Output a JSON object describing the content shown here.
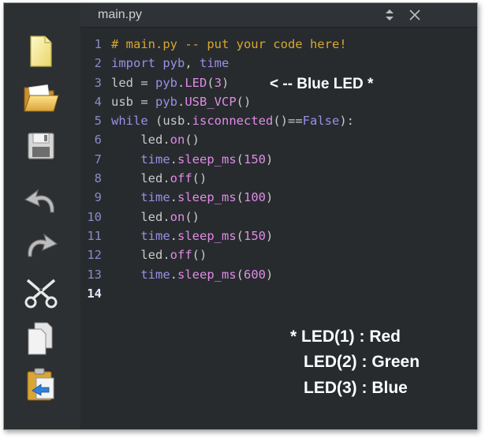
{
  "tab": {
    "title": "main.py"
  },
  "toolbar": {
    "buttons": [
      {
        "name": "new-file",
        "icon": "new-file-icon"
      },
      {
        "name": "open-folder",
        "icon": "folder-icon"
      },
      {
        "name": "save",
        "icon": "save-icon"
      },
      {
        "name": "undo",
        "icon": "undo-icon"
      },
      {
        "name": "redo",
        "icon": "redo-icon"
      },
      {
        "name": "cut",
        "icon": "scissors-icon"
      },
      {
        "name": "copy",
        "icon": "copy-icon"
      },
      {
        "name": "paste",
        "icon": "paste-icon"
      }
    ]
  },
  "code": {
    "lines": [
      {
        "n": "1",
        "tokens": [
          [
            "com",
            "# main.py -- put your code here!"
          ]
        ]
      },
      {
        "n": "2",
        "tokens": [
          [
            "kw",
            "import "
          ],
          [
            "mod",
            "pyb"
          ],
          [
            "op",
            ", "
          ],
          [
            "mod",
            "time"
          ]
        ]
      },
      {
        "n": "3",
        "tokens": [
          [
            "op",
            "led = "
          ],
          [
            "mod",
            "pyb"
          ],
          [
            "op",
            "."
          ],
          [
            "fn",
            "LED"
          ],
          [
            "op",
            "("
          ],
          [
            "num",
            "3"
          ],
          [
            "op",
            ")"
          ]
        ]
      },
      {
        "n": "4",
        "tokens": [
          [
            "op",
            "usb = "
          ],
          [
            "mod",
            "pyb"
          ],
          [
            "op",
            "."
          ],
          [
            "fn",
            "USB_VCP"
          ],
          [
            "op",
            "()"
          ]
        ]
      },
      {
        "n": "5",
        "tokens": [
          [
            "kw",
            "while "
          ],
          [
            "op",
            "(usb."
          ],
          [
            "fn",
            "isconnected"
          ],
          [
            "op",
            "()=="
          ],
          [
            "kw",
            "False"
          ],
          [
            "op",
            "):"
          ]
        ]
      },
      {
        "n": "6",
        "tokens": [
          [
            "op",
            "    led."
          ],
          [
            "fn",
            "on"
          ],
          [
            "op",
            "()"
          ]
        ]
      },
      {
        "n": "7",
        "tokens": [
          [
            "op",
            "    "
          ],
          [
            "mod",
            "time"
          ],
          [
            "op",
            "."
          ],
          [
            "fn",
            "sleep_ms"
          ],
          [
            "op",
            "("
          ],
          [
            "num",
            "150"
          ],
          [
            "op",
            ")"
          ]
        ]
      },
      {
        "n": "8",
        "tokens": [
          [
            "op",
            "    led."
          ],
          [
            "fn",
            "off"
          ],
          [
            "op",
            "()"
          ]
        ]
      },
      {
        "n": "9",
        "tokens": [
          [
            "op",
            "    "
          ],
          [
            "mod",
            "time"
          ],
          [
            "op",
            "."
          ],
          [
            "fn",
            "sleep_ms"
          ],
          [
            "op",
            "("
          ],
          [
            "num",
            "100"
          ],
          [
            "op",
            ")"
          ]
        ]
      },
      {
        "n": "10",
        "tokens": [
          [
            "op",
            "    led."
          ],
          [
            "fn",
            "on"
          ],
          [
            "op",
            "()"
          ]
        ]
      },
      {
        "n": "11",
        "tokens": [
          [
            "op",
            "    "
          ],
          [
            "mod",
            "time"
          ],
          [
            "op",
            "."
          ],
          [
            "fn",
            "sleep_ms"
          ],
          [
            "op",
            "("
          ],
          [
            "num",
            "150"
          ],
          [
            "op",
            ")"
          ]
        ]
      },
      {
        "n": "12",
        "tokens": [
          [
            "op",
            "    led."
          ],
          [
            "fn",
            "off"
          ],
          [
            "op",
            "()"
          ]
        ]
      },
      {
        "n": "13",
        "tokens": [
          [
            "op",
            "    "
          ],
          [
            "mod",
            "time"
          ],
          [
            "op",
            "."
          ],
          [
            "fn",
            "sleep_ms"
          ],
          [
            "op",
            "("
          ],
          [
            "num",
            "600"
          ],
          [
            "op",
            ")"
          ]
        ]
      },
      {
        "n": "14",
        "tokens": []
      }
    ]
  },
  "annotations": {
    "blue_led": "< -- Blue LED *",
    "legend_1": "* LED(1) : Red",
    "legend_2": "LED(2) : Green",
    "legend_3": "LED(3) : Blue"
  },
  "colors": {
    "background": "#272b2e",
    "comment": "#d8a72e",
    "keyword": "#9b8fe6",
    "function": "#e08ae6",
    "line_number": "#8a8ac8"
  }
}
